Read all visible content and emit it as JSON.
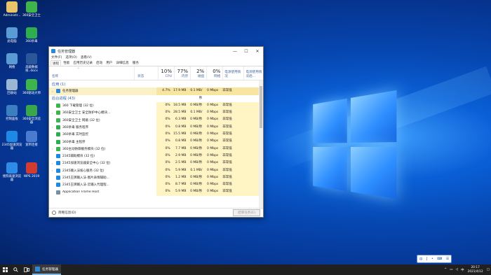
{
  "desktop": {
    "icons": [
      {
        "label": "Administr...",
        "color": "#e8c36a"
      },
      {
        "label": "360安全卫士",
        "color": "#3db54a"
      },
      {
        "label": "此电脑",
        "color": "#5b9bd5"
      },
      {
        "label": "360杀毒",
        "color": "#2fae4e"
      },
      {
        "label": "网络",
        "color": "#5b9bd5"
      },
      {
        "label": "高级数据排..docx",
        "color": "#2b579a"
      },
      {
        "label": "回收站",
        "color": "#9ab7d4"
      },
      {
        "label": "360驱动大师",
        "color": "#3db54a"
      },
      {
        "label": "控制面板",
        "color": "#3c7fc1"
      },
      {
        "label": "360安全浏览器",
        "color": "#3aa84a"
      },
      {
        "label": "2345加速浏览器",
        "color": "#1e88e5"
      },
      {
        "label": "宽带连接",
        "color": "#4a7bd1"
      },
      {
        "label": "搜狗高速浏览器",
        "color": "#2d8ce8"
      },
      {
        "label": "WPS 2019",
        "color": "#d23b2f"
      }
    ]
  },
  "window": {
    "title": "任务管理器",
    "controls": {
      "minimize": "—",
      "maximize": "☐",
      "close": "✕"
    },
    "menu": [
      "文件(F)",
      "选项(O)",
      "查看(V)"
    ],
    "tabs": [
      "进程",
      "性能",
      "应用历史记录",
      "启动",
      "用户",
      "详细信息",
      "服务"
    ],
    "active_tab": "进程",
    "columns": {
      "name": "名称",
      "status": "状态",
      "cpu": {
        "pct": "10%",
        "label": "CPU"
      },
      "mem": {
        "pct": "77%",
        "label": "内存"
      },
      "disk": {
        "pct": "2%",
        "label": "磁盘"
      },
      "net": {
        "pct": "0%",
        "label": "网络"
      },
      "power": "电源使用情况",
      "power_trend": "电源使用情况趋..."
    },
    "rows": [
      {
        "type": "group",
        "name": "应用 (1)"
      },
      {
        "type": "proc",
        "expand": true,
        "icon": "#2d89d8",
        "name": "任务管理器",
        "cpu": "4.7%",
        "mem": "17.9 MB",
        "disk": "0.1 MB/秒",
        "net": "0 Mbps",
        "power": "非常低",
        "selected": true
      },
      {
        "type": "group",
        "name": "后台进程 (43)"
      },
      {
        "type": "proc",
        "expand": false,
        "icon": "#3db54a",
        "name": "360 下载管理 (32 位)",
        "cpu": "0%",
        "mem": "18.5 MB",
        "disk": "0 MB/秒",
        "net": "0 Mbps",
        "power": "非常低"
      },
      {
        "type": "proc",
        "expand": true,
        "icon": "#3db54a",
        "name": "360安全卫士 安全防护中心模块...",
        "cpu": "0%",
        "mem": "28.5 MB",
        "disk": "0.1 MB/秒",
        "net": "0 Mbps",
        "power": "非常低"
      },
      {
        "type": "proc",
        "expand": false,
        "icon": "#3db54a",
        "name": "360安全卫士 网盾 (32 位)",
        "cpu": "0%",
        "mem": "6.3 MB",
        "disk": "0 MB/秒",
        "net": "0 Mbps",
        "power": "非常低"
      },
      {
        "type": "proc",
        "expand": true,
        "icon": "#2fae4e",
        "name": "360杀毒 服务程序",
        "cpu": "0%",
        "mem": "0.8 MB",
        "disk": "0 MB/秒",
        "net": "0 Mbps",
        "power": "非常低"
      },
      {
        "type": "proc",
        "expand": false,
        "icon": "#2fae4e",
        "name": "360杀毒 实时监控",
        "cpu": "0%",
        "mem": "15.5 MB",
        "disk": "0 MB/秒",
        "net": "0 Mbps",
        "power": "非常低"
      },
      {
        "type": "proc",
        "expand": false,
        "icon": "#2fae4e",
        "name": "360杀毒 主程序",
        "cpu": "0%",
        "mem": "0.8 MB",
        "disk": "0 MB/秒",
        "net": "0 Mbps",
        "power": "非常低"
      },
      {
        "type": "proc",
        "expand": true,
        "icon": "#3db54a",
        "name": "360主动防御服务模块 (32 位)",
        "cpu": "0%",
        "mem": "7.7 MB",
        "disk": "0 MB/秒",
        "net": "0 Mbps",
        "power": "非常低"
      },
      {
        "type": "proc",
        "expand": false,
        "icon": "#1e88e5",
        "name": "2345辅助模块 (32 位)",
        "cpu": "0%",
        "mem": "2.9 MB",
        "disk": "0 MB/秒",
        "net": "0 Mbps",
        "power": "非常低"
      },
      {
        "type": "proc",
        "expand": true,
        "icon": "#1e88e5",
        "name": "2345加速浏览器安全中心 (32 位)",
        "cpu": "0%",
        "mem": "2.5 MB",
        "disk": "0 MB/秒",
        "net": "0 Mbps",
        "power": "非常低"
      },
      {
        "type": "proc",
        "expand": true,
        "icon": "#1e88e5",
        "name": "2345输入法核心服务 (32 位)",
        "cpu": "0%",
        "mem": "5.9 MB",
        "disk": "0.1 MB/秒",
        "net": "0 Mbps",
        "power": "非常低"
      },
      {
        "type": "proc",
        "expand": false,
        "icon": "#1e88e5",
        "name": "2345王牌输入法-图片表情辅助...",
        "cpu": "0%",
        "mem": "1.2 MB",
        "disk": "0 MB/秒",
        "net": "0 Mbps",
        "power": "非常低"
      },
      {
        "type": "proc",
        "expand": false,
        "icon": "#1e88e5",
        "name": "2345王牌输入法-云输入代理程...",
        "cpu": "0%",
        "mem": "8.7 MB",
        "disk": "0 MB/秒",
        "net": "0 Mbps",
        "power": "非常低"
      },
      {
        "type": "proc",
        "expand": false,
        "icon": "#7b8da3",
        "name": "Application Frame Host",
        "cpu": "0%",
        "mem": "5.9 MB",
        "disk": "0 MB/秒",
        "net": "0 Mbps",
        "power": "非常低"
      }
    ],
    "footer": {
      "brief": "简略信息(D)",
      "end_task": "结束任务(E)"
    }
  },
  "taskbar": {
    "app_label": "任务管理器",
    "tray_text": "中",
    "time": "20:17",
    "date": "2021/4/12",
    "ime": [
      "中",
      "J",
      "•",
      "⌨",
      "☰"
    ]
  }
}
